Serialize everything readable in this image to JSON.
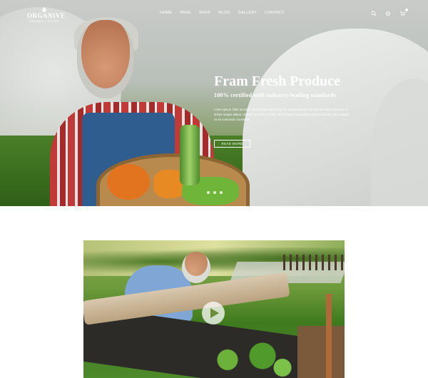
{
  "brand": {
    "name": "ORGANIVE",
    "tagline": "ORGANIC | STORE"
  },
  "nav": {
    "items": [
      "HOME",
      "PAGE",
      "SHOP",
      "BLOG",
      "GALLERY",
      "CONTACT"
    ]
  },
  "tools": {
    "icons": [
      "search-icon",
      "settings-icon",
      "cart-icon"
    ]
  },
  "hero": {
    "title": "Fram Fresh Produce",
    "subtitle": "100% certified with industry-leading standards",
    "body": "Lorem ipsum dolor sit amet, consectetur adipiscing elit, sed do eiusmod tempor incididunt ut labore et dolore magna aliqua. Ut enim ad minim veniam, quis nostrud exercitation ullamco laboris nisi ut aliquip ex ea commodo consequat.",
    "button": "READ MORE",
    "slides": 3,
    "active_slide": 1
  },
  "video": {
    "play_icon": "play-icon"
  },
  "colors": {
    "text_on_hero": "#ffffff",
    "page_bg": "#ffffff"
  }
}
